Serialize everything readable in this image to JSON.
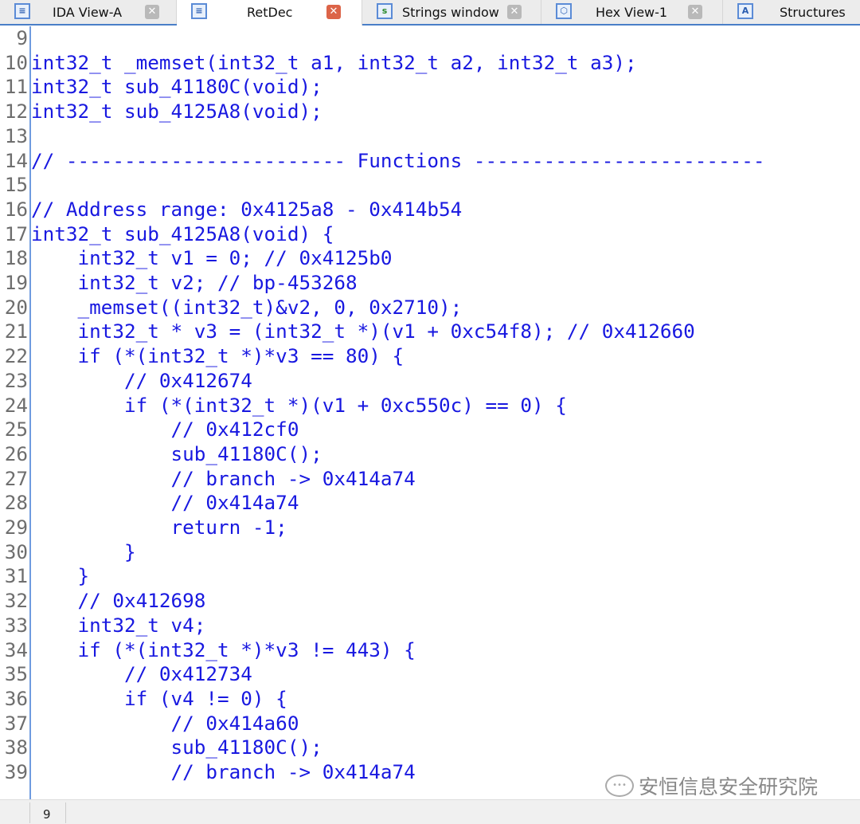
{
  "tabs": [
    {
      "label": "IDA View-A",
      "icon": "pseudocode-icon",
      "active": false
    },
    {
      "label": "RetDec",
      "icon": "pseudocode-icon",
      "active": true
    },
    {
      "label": "Strings window",
      "icon": "strings-icon",
      "active": false
    },
    {
      "label": "Hex View-1",
      "icon": "hex-icon",
      "active": false
    },
    {
      "label": "Structures",
      "icon": "structures-icon",
      "active": false
    }
  ],
  "code_lines": [
    {
      "n": "9",
      "t": ""
    },
    {
      "n": "10",
      "t": "int32_t _memset(int32_t a1, int32_t a2, int32_t a3);"
    },
    {
      "n": "11",
      "t": "int32_t sub_41180C(void);"
    },
    {
      "n": "12",
      "t": "int32_t sub_4125A8(void);"
    },
    {
      "n": "13",
      "t": ""
    },
    {
      "n": "14",
      "t": "// ------------------------ Functions -------------------------"
    },
    {
      "n": "15",
      "t": ""
    },
    {
      "n": "16",
      "t": "// Address range: 0x4125a8 - 0x414b54"
    },
    {
      "n": "17",
      "t": "int32_t sub_4125A8(void) {"
    },
    {
      "n": "18",
      "t": "    int32_t v1 = 0; // 0x4125b0"
    },
    {
      "n": "19",
      "t": "    int32_t v2; // bp-453268"
    },
    {
      "n": "20",
      "t": "    _memset((int32_t)&v2, 0, 0x2710);"
    },
    {
      "n": "21",
      "t": "    int32_t * v3 = (int32_t *)(v1 + 0xc54f8); // 0x412660"
    },
    {
      "n": "22",
      "t": "    if (*(int32_t *)*v3 == 80) {"
    },
    {
      "n": "23",
      "t": "        // 0x412674"
    },
    {
      "n": "24",
      "t": "        if (*(int32_t *)(v1 + 0xc550c) == 0) {"
    },
    {
      "n": "25",
      "t": "            // 0x412cf0"
    },
    {
      "n": "26",
      "t": "            sub_41180C();"
    },
    {
      "n": "27",
      "t": "            // branch -> 0x414a74"
    },
    {
      "n": "28",
      "t": "            // 0x414a74"
    },
    {
      "n": "29",
      "t": "            return -1;"
    },
    {
      "n": "30",
      "t": "        }"
    },
    {
      "n": "31",
      "t": "    }"
    },
    {
      "n": "32",
      "t": "    // 0x412698"
    },
    {
      "n": "33",
      "t": "    int32_t v4;"
    },
    {
      "n": "34",
      "t": "    if (*(int32_t *)*v3 != 443) {"
    },
    {
      "n": "35",
      "t": "        // 0x412734"
    },
    {
      "n": "36",
      "t": "        if (v4 != 0) {"
    },
    {
      "n": "37",
      "t": "            // 0x414a60"
    },
    {
      "n": "38",
      "t": "            sub_41180C();"
    },
    {
      "n": "39",
      "t": "            // branch -> 0x414a74"
    }
  ],
  "status": {
    "line": "9"
  },
  "watermark": "安恒信息安全研究院",
  "colors": {
    "code": "#1818e0",
    "accent": "#4a7fc8",
    "close_active": "#dc6448"
  }
}
